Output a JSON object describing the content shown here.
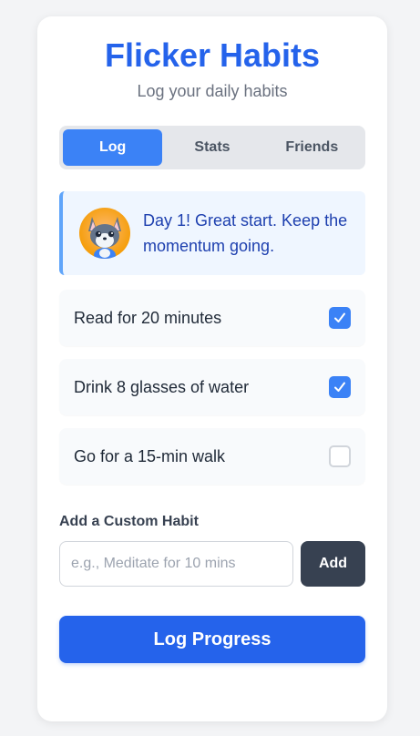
{
  "app": {
    "title": "Flicker Habits",
    "subtitle": "Log your daily habits",
    "accent_color": "#2563eb"
  },
  "tabs": [
    {
      "label": "Log",
      "active": true
    },
    {
      "label": "Stats",
      "active": false
    },
    {
      "label": "Friends",
      "active": false
    }
  ],
  "banner": {
    "avatar_icon": "fox-mascot-icon",
    "message": "Day 1! Great start. Keep the momentum going."
  },
  "habits": [
    {
      "label": "Read for 20 minutes",
      "checked": true
    },
    {
      "label": "Drink 8 glasses of water",
      "checked": true
    },
    {
      "label": "Go for a 15-min walk",
      "checked": false
    }
  ],
  "custom_habit": {
    "label": "Add a Custom Habit",
    "placeholder": "e.g., Meditate for 10 mins",
    "value": "",
    "add_label": "Add"
  },
  "actions": {
    "log_label": "Log Progress"
  }
}
